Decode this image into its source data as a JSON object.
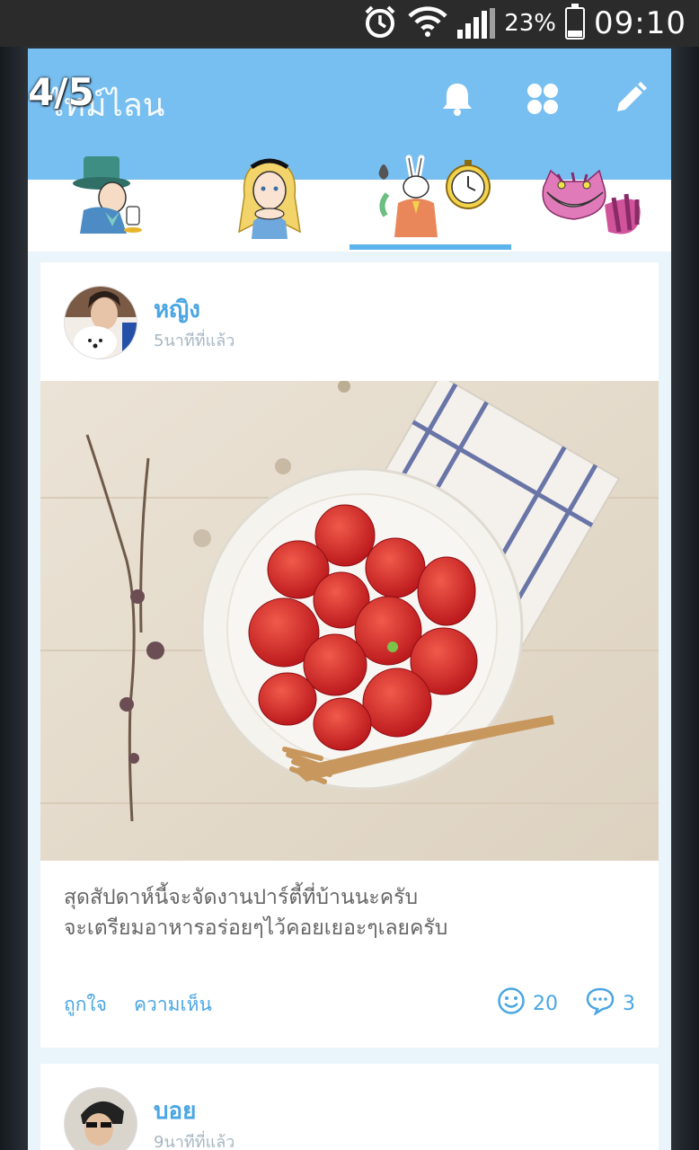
{
  "status_bar": {
    "battery_percent": "23%",
    "battery_level": 0.23,
    "time": "09:10"
  },
  "header": {
    "title": "ไทม์ไลน",
    "page_counter": "4/5"
  },
  "tabs": [
    {
      "icon": "mad-hatter-sticker"
    },
    {
      "icon": "alice-sticker"
    },
    {
      "icon": "white-rabbit-sticker",
      "selected": true
    },
    {
      "icon": "cheshire-cat-sticker"
    }
  ],
  "posts": [
    {
      "author": "หญิง",
      "time": "5นาทีที่แล้ว",
      "caption_lines": [
        "สุดสัปดาห์นี้จะจัดงานปาร์ตี้ที่บ้านนะครับ",
        "จะเตรียมอาหารอร่อยๆไว้คอยเยอะๆเลยครับ"
      ],
      "like_label": "ถูกใจ",
      "comment_label": "ความเห็น",
      "like_count": "20",
      "comment_count": "3"
    },
    {
      "author": "บอย",
      "time": "9นาทีที่แล้ว"
    }
  ],
  "colors": {
    "header": "#78bff1",
    "accent": "#4aa6e3",
    "tab_indicator": "#5fb3ec",
    "background": "#eaf4fb"
  }
}
